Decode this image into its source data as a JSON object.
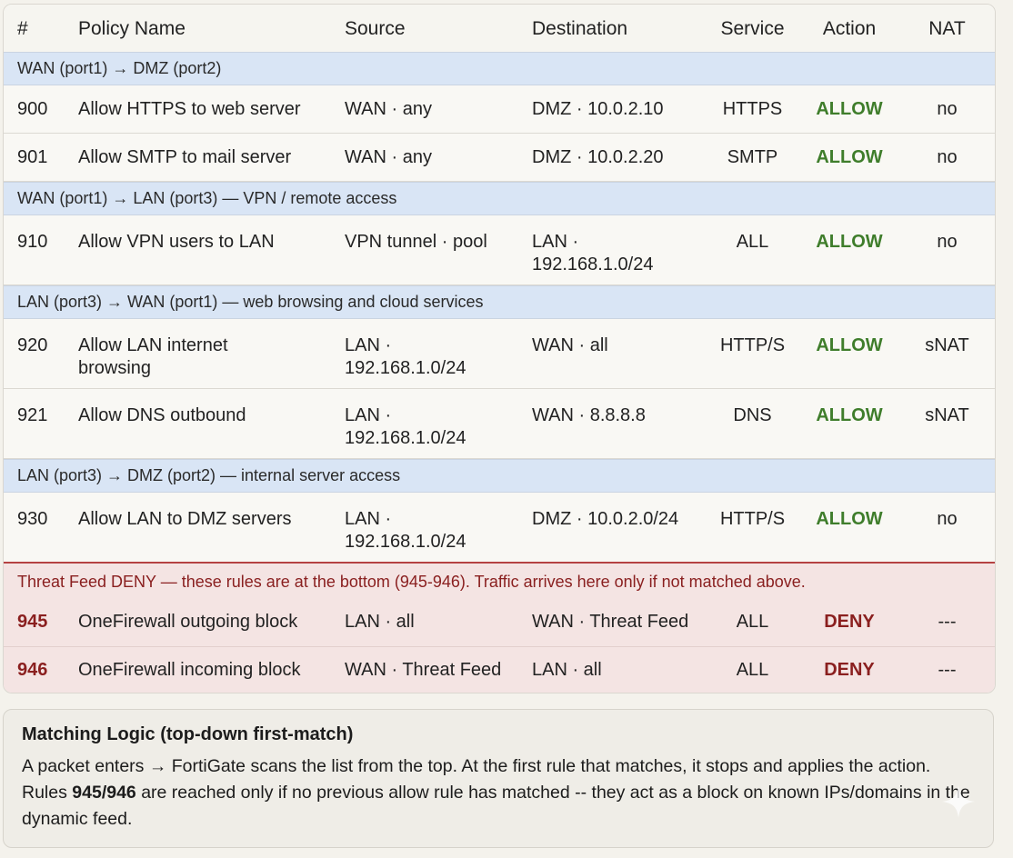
{
  "header": {
    "num": "#",
    "name": "Policy Name",
    "source": "Source",
    "destination": "Destination",
    "service": "Service",
    "action": "Action",
    "nat": "NAT"
  },
  "groups": [
    {
      "label": "WAN (port1) → DMZ (port2)",
      "rules": [
        {
          "num": "900",
          "name": "Allow HTTPS to web server",
          "source": "WAN · any",
          "destination": "DMZ · 10.0.2.10",
          "service": "HTTPS",
          "action": "ALLOW",
          "nat": "no"
        },
        {
          "num": "901",
          "name": "Allow SMTP to mail server",
          "source": "WAN · any",
          "destination": "DMZ · 10.0.2.20",
          "service": "SMTP",
          "action": "ALLOW",
          "nat": "no"
        }
      ]
    },
    {
      "label": "WAN (port1) → LAN (port3) — VPN / remote access",
      "rules": [
        {
          "num": "910",
          "name": "Allow VPN users to LAN",
          "source": "VPN tunnel · pool",
          "destination": "LAN · 192.168.1.0/24",
          "service": "ALL",
          "action": "ALLOW",
          "nat": "no"
        }
      ]
    },
    {
      "label": "LAN (port3) → WAN (port1) — web browsing and cloud services",
      "rules": [
        {
          "num": "920",
          "name": "Allow LAN internet browsing",
          "source": "LAN · 192.168.1.0/24",
          "destination": "WAN · all",
          "service": "HTTP/S",
          "action": "ALLOW",
          "nat": "sNAT"
        },
        {
          "num": "921",
          "name": "Allow DNS outbound",
          "source": "LAN · 192.168.1.0/24",
          "destination": "WAN · 8.8.8.8",
          "service": "DNS",
          "action": "ALLOW",
          "nat": "sNAT"
        }
      ]
    },
    {
      "label": "LAN (port3) → DMZ (port2) — internal server access",
      "rules": [
        {
          "num": "930",
          "name": "Allow LAN to DMZ servers",
          "source": "LAN · 192.168.1.0/24",
          "destination": "DMZ · 10.0.2.0/24",
          "service": "HTTP/S",
          "action": "ALLOW",
          "nat": "no"
        }
      ]
    }
  ],
  "threat": {
    "note": "Threat Feed DENY — these rules are at the bottom (945-946). Traffic arrives here only if not matched above.",
    "rules": [
      {
        "num": "945",
        "name": "OneFirewall outgoing block",
        "source": "LAN · all",
        "destination": "WAN · Threat Feed",
        "service": "ALL",
        "action": "DENY",
        "nat": "---"
      },
      {
        "num": "946",
        "name": "OneFirewall incoming block",
        "source": "WAN · Threat Feed",
        "destination": "LAN · all",
        "service": "ALL",
        "action": "DENY",
        "nat": "---"
      }
    ]
  },
  "logic": {
    "title": "Matching Logic (top-down first-match)",
    "line1": "A packet enters → FortiGate scans the list from the top. At the first rule that matches, it stops and applies the action.",
    "line2_pre": "Rules ",
    "line2_bold": "945/946",
    "line2_post": " are reached only if no previous allow rule has matched -- they act as a block on known IPs/domains in the dynamic feed."
  },
  "colors": {
    "allow": "#3f7d2b",
    "deny": "#8a1f1f",
    "group_band": "#d9e5f5",
    "deny_zone": "#f4e4e3"
  },
  "icons": {
    "corner": "sparkle-icon"
  }
}
